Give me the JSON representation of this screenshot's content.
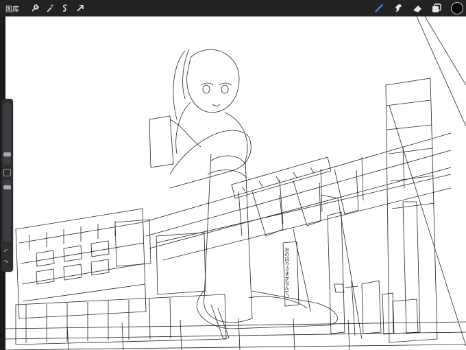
{
  "topbar": {
    "gallery_label": "图库",
    "left_tools": [
      "wrench-icon",
      "magic-wand-icon",
      "selection-s-icon",
      "transform-arrow-icon"
    ],
    "right_tools": [
      "brush-icon",
      "smudge-icon",
      "eraser-icon",
      "layers-icon"
    ],
    "active_tool": "brush-icon",
    "accent_color": "#3b82f6",
    "current_color": "#000000"
  },
  "sidebar": {
    "brush_size_level": 0.45,
    "opacity_level": 0.15,
    "undo_icon": "undo-icon",
    "redo_icon": "redo-icon"
  },
  "canvas": {
    "sign_text": "おのぼりさまがなんて。"
  }
}
